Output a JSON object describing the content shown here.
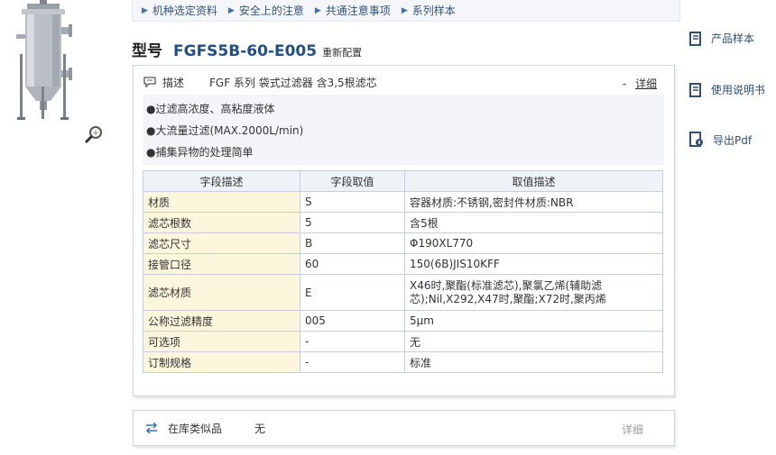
{
  "nav": {
    "items": [
      {
        "label": "机种选定资料"
      },
      {
        "label": "安全上的注意"
      },
      {
        "label": "共通注意事项"
      },
      {
        "label": "系列样本"
      }
    ]
  },
  "product": {
    "title_label": "型号",
    "model": "FGFS5B-60-E005",
    "subtitle": "重新配置",
    "image_icon": "filter-housing-image",
    "zoom_icon": "zoom-icon"
  },
  "side_links": [
    {
      "label": "产品样本",
      "icon": "book-icon"
    },
    {
      "label": "使用说明书",
      "icon": "book-icon"
    },
    {
      "label": "导出Pdf",
      "icon": "pdf-export-icon"
    }
  ],
  "panel": {
    "desc_label": "描述",
    "desc_text": "FGF 系列 袋式过滤器 含3,5根滤芯",
    "detail_dash": "-",
    "detail_link": "详细",
    "features": [
      "●过滤高浓度、高粘度液体",
      "●大流量过滤(MAX.2000L/min)",
      "●捕集异物的处理简单"
    ]
  },
  "spec_table": {
    "headers": [
      "字段描述",
      "字段取值",
      "取值描述"
    ],
    "rows": [
      [
        "材质",
        "S",
        "容器材质:不锈钢,密封件材质:NBR"
      ],
      [
        "滤芯根数",
        "5",
        "含5根"
      ],
      [
        "滤芯尺寸",
        "B",
        "Φ190XL770"
      ],
      [
        "接管口径",
        "60",
        "150(6B)JIS10KFF"
      ],
      [
        "滤芯材质",
        "E",
        "X46时,聚酯(标准滤芯),聚氯乙烯(辅助滤芯);Nil,X292,X47时,聚酯;X72时,聚丙烯"
      ],
      [
        "公称过滤精度",
        "005",
        "5μm"
      ],
      [
        "可选项",
        "-",
        "无"
      ],
      [
        "订制规格",
        "-",
        "标准"
      ]
    ]
  },
  "stock": {
    "label": "在库类似品",
    "value": "无",
    "detail": "详细"
  },
  "colors": {
    "model_blue": "#1f4f86",
    "field_highlight": "#fbf6dc",
    "header_bg": "#eef3f8"
  }
}
